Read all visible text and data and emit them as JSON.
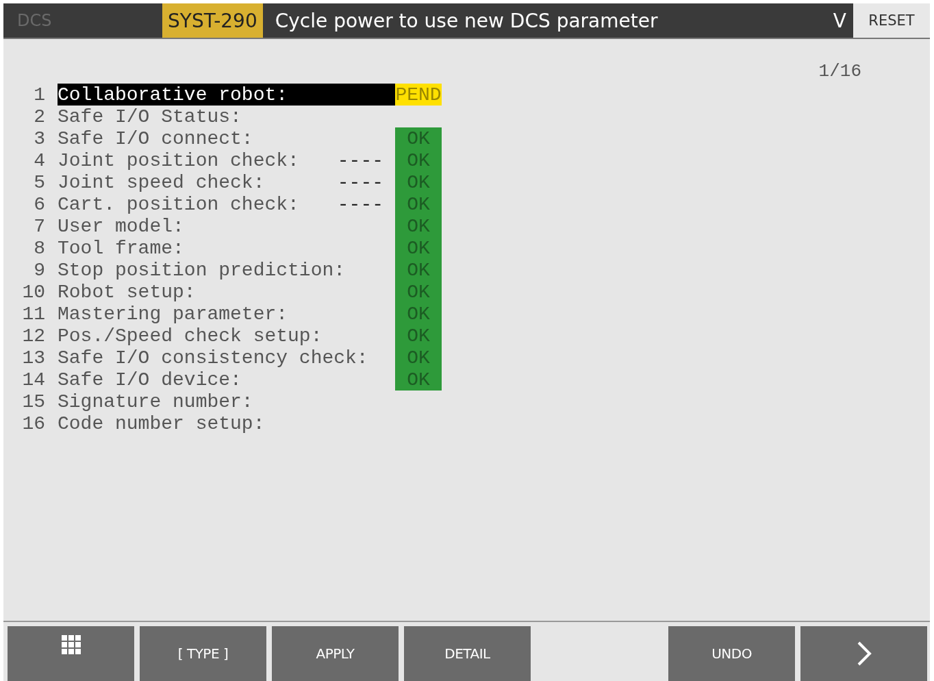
{
  "top_bar": {
    "menu": "DCS",
    "alarm_code": "SYST-290",
    "message": "Cycle power to use new DCS parameter",
    "expand": "V",
    "reset": "RESET"
  },
  "page_indicator": "1/16",
  "rows": [
    {
      "number": "1",
      "label": "Collaborative robot:",
      "status": "PEND",
      "color": "#ffe000",
      "selected": true
    },
    {
      "number": "2",
      "label": "Safe I/O Status:",
      "selected": false
    },
    {
      "number": "3",
      "label": "Safe I/O connect:",
      "status": "OK",
      "color": "#2e9a3a",
      "selected": false
    },
    {
      "number": "4",
      "label": "Joint position check:",
      "dashes": "----",
      "status": "OK",
      "color": "#2e9a3a",
      "selected": false
    },
    {
      "number": "5",
      "label": "Joint speed check:",
      "dashes": "----",
      "status": "OK",
      "color": "#2e9a3a",
      "selected": false
    },
    {
      "number": "6",
      "label": "Cart. position check:",
      "dashes": "----",
      "status": "OK",
      "color": "#2e9a3a",
      "selected": false
    },
    {
      "number": "7",
      "label": "User model:",
      "status": "OK",
      "color": "#2e9a3a",
      "selected": false
    },
    {
      "number": "8",
      "label": "Tool frame:",
      "status": "OK",
      "color": "#2e9a3a",
      "selected": false
    },
    {
      "number": "9",
      "label": "Stop position prediction:",
      "status": "OK",
      "color": "#2e9a3a",
      "selected": false
    },
    {
      "number": "10",
      "label": "Robot setup:",
      "status": "OK",
      "color": "#2e9a3a",
      "selected": false
    },
    {
      "number": "11",
      "label": "Mastering parameter:",
      "status": "OK",
      "color": "#2e9a3a",
      "selected": false
    },
    {
      "number": "12",
      "label": "Pos./Speed check setup:",
      "status": "OK",
      "color": "#2e9a3a",
      "selected": false
    },
    {
      "number": "13",
      "label": "Safe I/O consistency check:",
      "status": "OK",
      "color": "#2e9a3a",
      "selected": false
    },
    {
      "number": "14",
      "label": "Safe I/O device:",
      "status": "OK",
      "color": "#2e9a3a",
      "selected": false
    },
    {
      "number": "15",
      "label": "Signature number:",
      "selected": false
    },
    {
      "number": "16",
      "label": "Code number setup:",
      "selected": false
    }
  ],
  "function_keys": [
    {
      "kind": "grid"
    },
    {
      "kind": "text",
      "label": "[ TYPE ]"
    },
    {
      "kind": "text",
      "label": "APPLY"
    },
    {
      "kind": "text",
      "label": "DETAIL"
    },
    {
      "kind": "blank"
    },
    {
      "kind": "text",
      "label": "UNDO"
    },
    {
      "kind": "next"
    }
  ]
}
